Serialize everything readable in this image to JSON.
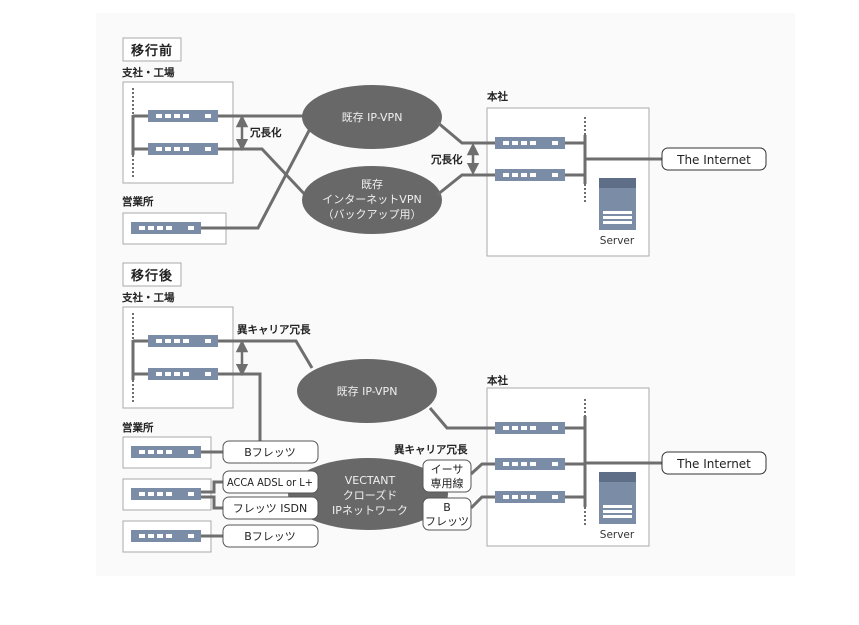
{
  "colors": {
    "background_panel": "#fafafa",
    "line": "#6e6e6e",
    "ellipse": "#686868",
    "device": "#7b8ca6",
    "device_port": "#ffffff",
    "box_border": "#a9a9a9",
    "server_top": "#5d6e86",
    "server_body": "#7b8ca6"
  },
  "before": {
    "section_title": "移行前",
    "branch_label": "支社・工場",
    "sales_label": "営業所",
    "redundancy_label": "冗長化",
    "hq_redundancy_label": "冗長化",
    "hq_label": "本社",
    "vpn_main": "既存 IP-VPN",
    "vpn_backup_lines": [
      "既存",
      "インターネットVPN",
      "（バックアップ用）"
    ],
    "internet_label": "The Internet",
    "server_label": "Server"
  },
  "after": {
    "section_title": "移行後",
    "branch_label": "支社・工場",
    "sales_label": "営業所",
    "carrier_redundancy_label": "異キャリア冗長",
    "hq_carrier_redundancy_label": "異キャリア冗長",
    "hq_label": "本社",
    "vpn_main": "既存 IP-VPN",
    "vectant_lines": [
      "VECTANT",
      "クローズド",
      "IPネットワーク"
    ],
    "access_lines": [
      "Bフレッツ",
      "ACCA ADSL or L+",
      "フレッツ ISDN",
      "Bフレッツ"
    ],
    "hq_access_1_lines": [
      "イーサ",
      "専用線"
    ],
    "hq_access_2_lines": [
      "B",
      "フレッツ"
    ],
    "internet_label": "The Internet",
    "server_label": "Server"
  }
}
